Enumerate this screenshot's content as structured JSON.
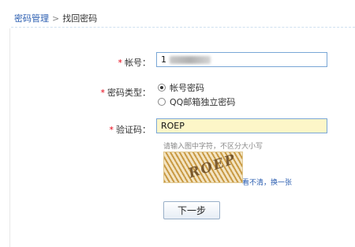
{
  "breadcrumb": {
    "parent": "密码管理",
    "separator": ">",
    "current": "找回密码"
  },
  "account": {
    "required_mark": "*",
    "label": "帐号：",
    "value": "1"
  },
  "password_type": {
    "required_mark": "*",
    "label": "密码类型：",
    "options": [
      {
        "label": "帐号密码",
        "checked": true
      },
      {
        "label": "QQ邮箱独立密码",
        "checked": false
      }
    ]
  },
  "captcha": {
    "required_mark": "*",
    "label": "验证码：",
    "value": "ROEP",
    "hint": "请输入图中字符，不区分大小写",
    "image_text": "ROEP",
    "refresh_label": "看不清，换一张"
  },
  "next_button": "下一步",
  "colors": {
    "required": "#e60012",
    "link": "#2a5db0",
    "captcha_input_bg": "#fdf6c8",
    "input_border": "#7aa7d6"
  }
}
